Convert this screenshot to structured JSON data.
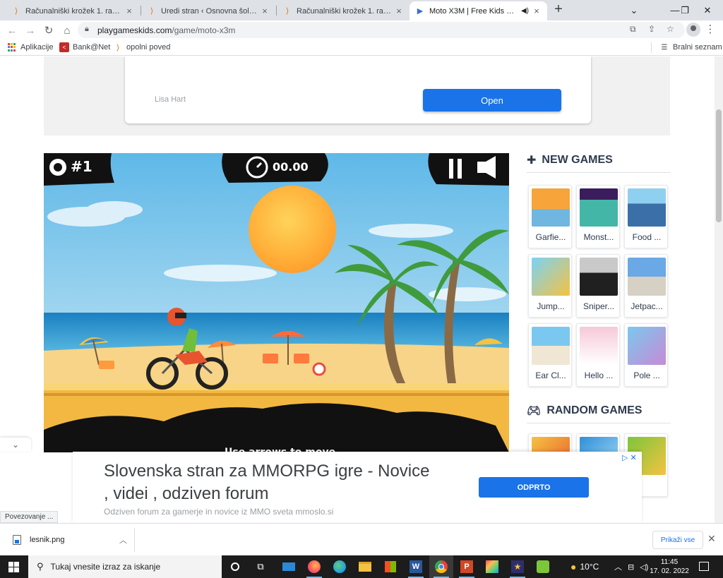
{
  "browser": {
    "tabs": [
      {
        "title": "Računalniški krožek 1. razred – O",
        "active": false
      },
      {
        "title": "Uredi stran ‹ Osnovna šola Sveti",
        "active": false
      },
      {
        "title": "Računalniški krožek 1. razred – O",
        "active": false
      },
      {
        "title": "Moto X3M | Free Kids Games",
        "active": true
      }
    ],
    "address": {
      "domain": "playgameskids.com",
      "path": "/game/moto-x3m"
    },
    "bookmarks": [
      {
        "label": "Aplikacije",
        "icon": "apps-grid-icon"
      },
      {
        "label": "Bank@Net",
        "icon": "bank-icon"
      },
      {
        "label": "opolni poved",
        "icon": "site-icon"
      }
    ],
    "reading_list": "Bralni seznam"
  },
  "top_ad": {
    "name": "Lisa Hart",
    "button": "Open"
  },
  "game": {
    "rank": "#1",
    "timer": "00.00",
    "caption": "Use arrows to move"
  },
  "sidebar": {
    "new_games_title": "NEW GAMES",
    "new_games": [
      {
        "name": "Garfie...",
        "theme": "garfield"
      },
      {
        "name": "Monst...",
        "theme": "monster"
      },
      {
        "name": "Food ...",
        "theme": "food"
      },
      {
        "name": "Jump...",
        "theme": "jump"
      },
      {
        "name": "Sniper...",
        "theme": "sniper"
      },
      {
        "name": "Jetpac...",
        "theme": "jetpack"
      },
      {
        "name": "Ear Cl...",
        "theme": "ear"
      },
      {
        "name": "Hello ...",
        "theme": "hello"
      },
      {
        "name": "Pole ...",
        "theme": "pole"
      }
    ],
    "random_games_title": "RANDOM GAMES"
  },
  "bottom_ad": {
    "headline": "Slovenska stran za MMORPG igre - Novice , videi , odziven forum",
    "subline": "Odziven forum za gamerje in novice iz MMO sveta mmoslo.si",
    "button": "ODPRTO"
  },
  "status_text": "Povezovanje ...",
  "downloads": {
    "file": "lesnik.png",
    "show_all": "Prikaži vse"
  },
  "taskbar": {
    "search_placeholder": "Tukaj vnesite izraz za iskanje",
    "weather": "10°C",
    "time": "11:45",
    "date": "17. 02. 2022"
  },
  "colors": {
    "accent": "#1a73e8",
    "sidebar_heading": "#2e3b4e",
    "taskbar": "#1c1c1c"
  }
}
